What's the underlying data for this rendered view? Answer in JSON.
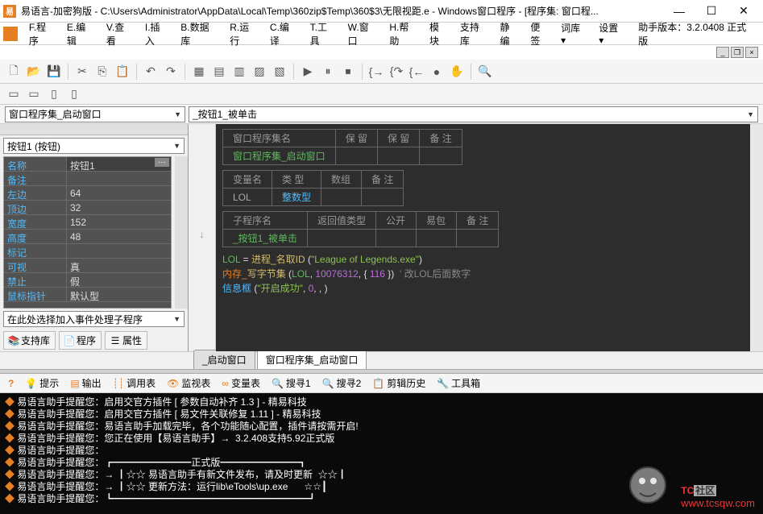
{
  "title": "易语言-加密狗版 - C:\\Users\\Administrator\\AppData\\Local\\Temp\\360zip$Temp\\360$3\\无限视距.e - Windows窗口程序 - [程序集: 窗口程...",
  "menus": [
    "F.程序",
    "E.编辑",
    "V.查看",
    "I.插入",
    "B.数据库",
    "R.运行",
    "C.编译",
    "T.工具",
    "W.窗口",
    "H.帮助",
    "模块",
    "支持库",
    "静编",
    "便签",
    "词库 ▾",
    "设置 ▾"
  ],
  "version_label": "助手版本：3.2.0408 正式版",
  "combo_left": "窗口程序集_启动窗口",
  "combo_right": "_按钮1_被单击",
  "object_combo": "按钮1 (按钮)",
  "props": [
    {
      "name": "名称",
      "val": "按钮1",
      "ellipsis": true
    },
    {
      "name": "备注",
      "val": ""
    },
    {
      "name": "左边",
      "val": "64"
    },
    {
      "name": "顶边",
      "val": "32"
    },
    {
      "name": "宽度",
      "val": "152"
    },
    {
      "name": "高度",
      "val": "48"
    },
    {
      "name": "标记",
      "val": ""
    },
    {
      "name": "可视",
      "val": "真"
    },
    {
      "name": "禁止",
      "val": "假"
    },
    {
      "name": "鼠标指针",
      "val": "默认型"
    }
  ],
  "event_placeholder": "在此处选择加入事件处理子程序",
  "left_tabs": {
    "support": "支持库",
    "program": "程序",
    "properties": "属性"
  },
  "code_tables": {
    "t1": {
      "headers": [
        "窗口程序集名",
        "保 留",
        "保 留",
        "备 注"
      ],
      "row": [
        "窗口程序集_启动窗口",
        "",
        "",
        ""
      ]
    },
    "t2": {
      "headers": [
        "变量名",
        "类 型",
        "数组",
        "备 注"
      ],
      "row": [
        "LOL",
        "整数型",
        "",
        ""
      ]
    },
    "t3": {
      "headers": [
        "子程序名",
        "返回值类型",
        "公开",
        "易包",
        "备 注"
      ],
      "row": [
        "_按钮1_被单击",
        "",
        "",
        "",
        ""
      ]
    }
  },
  "code": {
    "l1a": "LOL",
    "l1b": " = ",
    "l1c": "进程_名取ID",
    "l1d": " (",
    "l1e": "\"League of Legends.exe\"",
    "l1f": ")",
    "l2a": "内存_",
    "l2b": "写字节集",
    "l2c": " (",
    "l2d": "LOL",
    "l2e": ", ",
    "l2f": "10076312",
    "l2g": ", { ",
    "l2h": "116",
    "l2i": " })  ",
    "l2j": "' 改LOL后面数字",
    "l3a": "信息框",
    "l3b": " (",
    "l3c": "\"开启成功\"",
    "l3d": ", ",
    "l3e": "0",
    "l3f": ", , )"
  },
  "editor_tabs": [
    "_启动窗口",
    "窗口程序集_启动窗口"
  ],
  "bottom_tabs": [
    "提示",
    "输出",
    "调用表",
    "监视表",
    "变量表",
    "搜寻1",
    "搜寻2",
    "剪辑历史",
    "工具箱"
  ],
  "console": [
    "易语言助手提醒您：启用交官方插件 [ 参数自动补齐 1.3 ] - 精易科技",
    "易语言助手提醒您：启用交官方插件 [ 易文件关联修复 1.11 ] - 精易科技",
    "易语言助手提醒您：易语言助手加载完毕，各个功能随心配置，插件请按需开启!",
    "易语言助手提醒您：您正在使用【易语言助手】→  3.2.408支持5.92正式版",
    "易语言助手提醒您：",
    "易语言助手提醒您：┏━━━━━━━━正式版━━━━━━━━┓",
    "易语言助手提醒您：→ ┃☆☆ 易语言助手有新文件发布，请及时更新  ☆☆┃",
    "易语言助手提醒您：→ ┃☆☆ 更新方法：运行lib\\eTools\\up.exe      ☆☆┃",
    "易语言助手提醒您：┗━━━━━━━━━━━━━━━━━━━━┛"
  ],
  "watermark": {
    "tc": "TC",
    "sq": "社区",
    "url": "www.tcsqw.com"
  }
}
